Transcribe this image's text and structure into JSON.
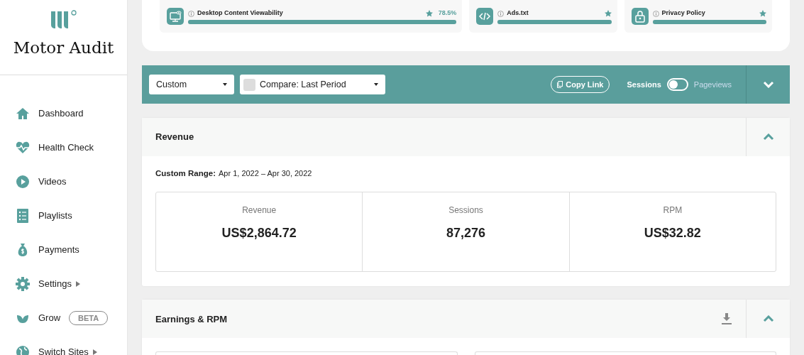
{
  "brand": {
    "name": "Motor Audit"
  },
  "sidebar": {
    "items": [
      {
        "label": "Dashboard",
        "has_submenu": false
      },
      {
        "label": "Health Check",
        "has_submenu": false
      },
      {
        "label": "Videos",
        "has_submenu": false
      },
      {
        "label": "Playlists",
        "has_submenu": false
      },
      {
        "label": "Payments",
        "has_submenu": false
      },
      {
        "label": "Settings",
        "has_submenu": true
      },
      {
        "label": "Grow",
        "has_submenu": false,
        "badge": "BETA"
      },
      {
        "label": "Switch Sites",
        "has_submenu": true
      }
    ]
  },
  "scores": [
    {
      "label": "Desktop Content Viewability",
      "value": "78.5%",
      "level": 1
    },
    {
      "label": "Ads.txt",
      "level": 1
    },
    {
      "label": "Privacy Policy",
      "level": 1
    }
  ],
  "toolbar": {
    "range_select": {
      "value": "Custom"
    },
    "compare_select": {
      "value": "Compare: Last Period",
      "checked": false
    },
    "copy_link": "Copy Link",
    "toggle": {
      "left_label": "Sessions",
      "right_label": "Pageviews",
      "on": false
    },
    "expanded": false
  },
  "revenue": {
    "title": "Revenue",
    "expanded": true,
    "range_label": "Custom Range:",
    "range_value": "Apr 1, 2022 – Apr 30, 2022",
    "metrics": [
      {
        "label": "Revenue",
        "value": "US$2,864.72"
      },
      {
        "label": "Sessions",
        "value": "87,276"
      },
      {
        "label": "RPM",
        "value": "US$32.82"
      }
    ]
  },
  "earnings": {
    "title": "Earnings & RPM",
    "expanded": true
  }
}
